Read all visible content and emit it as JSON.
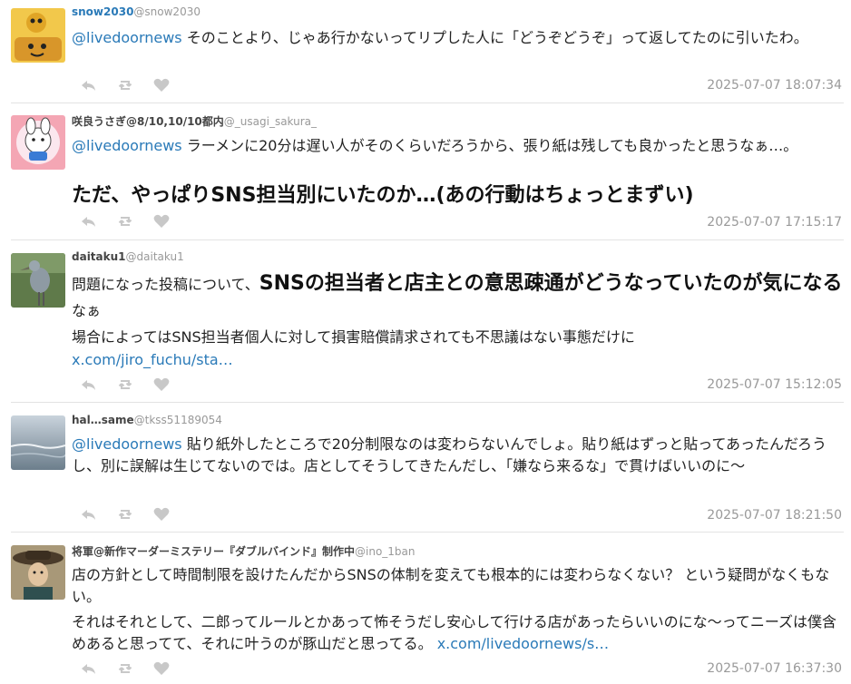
{
  "tweets": [
    {
      "name": "snow2030",
      "handle": "@snow2030",
      "mention": "@livedoornews",
      "text": " そのことより、じゃあ行かないってリプした人に「どうぞどうぞ」って返してたのに引いたわ。",
      "time": "2025-07-07 18:07:34"
    },
    {
      "name": "咲良うさぎ@8/10,10/10都内",
      "handle": "@_usagi_sakura_",
      "mention": "@livedoornews",
      "text": " ラーメンに20分は遅い人がそのくらいだろうから、張り紙は残しても良かったと思うなぁ…。",
      "big": "ただ、やっぱりSNS担当別にいたのか…(あの行動はちょっとまずい)",
      "time": "2025-07-07 17:15:17"
    },
    {
      "name": "daitaku1",
      "handle": "@daitaku1",
      "text_a": "問題になった投稿について、",
      "big": "SNSの担当者と店主との意思疎通がどうなっていたのが気になる",
      "text_b": "なぁ",
      "text_c": "場合によってはSNS担当者個人に対して損害賠償請求されても不思議はない事態だけに",
      "link": "x.com/jiro_fuchu/sta…",
      "time": "2025-07-07 15:12:05"
    },
    {
      "name": "hal…same",
      "handle": "@tkss51189054",
      "mention": "@livedoornews",
      "text": " 貼り紙外したところで20分制限なのは変わらないんでしょ。貼り紙はずっと貼ってあったんだろうし、別に誤解は生じてないのでは。店としてそうしてきたんだし、「嫌なら来るな」で貫けばいいのに〜",
      "time": "2025-07-07 18:21:50"
    },
    {
      "name": "将軍@新作マーダーミステリー『ダブルバインド』制作中",
      "handle": "@ino_1ban",
      "text_a": "店の方針として時間制限を設けたんだからSNSの体制を変えても根本的には変わらなくない？ という疑問がなくもない。",
      "text_b": "それはそれとして、二郎ってルールとかあって怖そうだし安心して行ける店があったらいいのにな〜ってニーズは僕含めあると思ってて、それに叶うのが豚山だと思ってる。 ",
      "link": "x.com/livedoornews/s…",
      "time": "2025-07-07 16:37:30"
    }
  ],
  "colors": {
    "link": "#2a7ab8",
    "meta": "#999999",
    "divider": "#e3e3e3"
  },
  "icons": [
    "reply-icon",
    "retweet-icon",
    "like-icon"
  ]
}
